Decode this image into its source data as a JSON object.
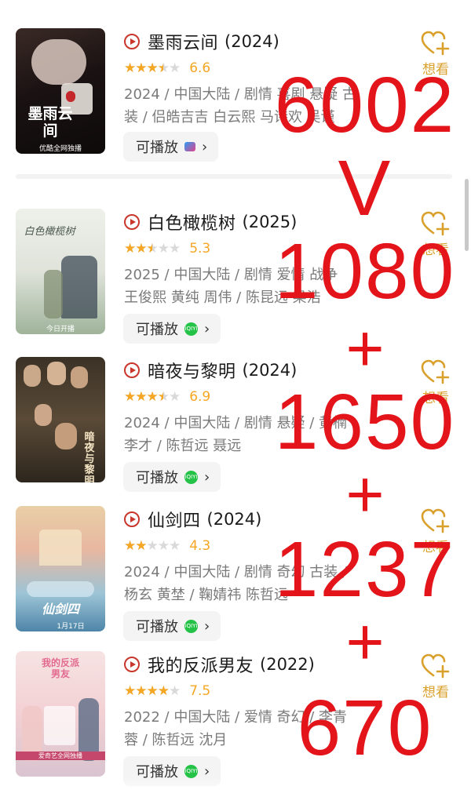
{
  "items": [
    {
      "title": "墨雨云间",
      "year": "(2024)",
      "stars": 3.5,
      "score": "6.6",
      "meta_line1": "2024 / 中国大陆 / 剧情 喜剧 悬疑 古",
      "meta_line2": "装 / 侣皓吉吉 白云熙 马诗欢 吴谨",
      "playable_label": "可播放",
      "platform": "youku",
      "want_label": "想看",
      "poster_text": "墨雨云间",
      "poster_caption": "优酷全网独播"
    },
    {
      "title": "白色橄榄树",
      "year": "(2025)",
      "stars": 2.5,
      "score": "5.3",
      "meta_line1": "2025 / 中国大陆 / 剧情 爱情 战争",
      "meta_line2": "王俊熙 黄纯 周伟 / 陈昆远 梁浩",
      "playable_label": "可播放",
      "platform": "iqiyi",
      "want_label": "想看",
      "poster_text": "白色橄榄树",
      "poster_caption": "今日开播"
    },
    {
      "title": "暗夜与黎明",
      "year": "(2024)",
      "stars": 3.5,
      "score": "6.9",
      "meta_line1": "2024 / 中国大陆 / 剧情 悬疑 / 黄楠",
      "meta_line2": "李才 / 陈哲远 聂远",
      "playable_label": "可播放",
      "platform": "iqiyi",
      "want_label": "想看",
      "poster_text": "暗夜与黎明",
      "poster_caption": ""
    },
    {
      "title": "仙剑四",
      "year": "(2024)",
      "stars": 2,
      "score": "4.3",
      "meta_line1": "2024 / 中国大陆 / 剧情 奇幻 古装 /",
      "meta_line2": "杨玄 黄埜 / 鞠婧祎 陈哲远",
      "playable_label": "可播放",
      "platform": "iqiyi",
      "want_label": "想看",
      "poster_text": "仙剑四",
      "poster_caption": "1月17日"
    },
    {
      "title": "我的反派男友",
      "year": "(2022)",
      "stars": 4,
      "score": "7.5",
      "meta_line1": "2022 / 中国大陆 / 爱情 奇幻 / 李青",
      "meta_line2": "蓉 / 陈哲远 沈月",
      "playable_label": "可播放",
      "platform": "iqiyi",
      "want_label": "想看",
      "poster_text": "我的反派男友",
      "poster_caption": "爱奇艺全网独播"
    }
  ],
  "overlay": {
    "n1": "6002",
    "v": "V",
    "n2": "1080",
    "plus1": "+",
    "n3": "1650",
    "plus2": "+",
    "n4": "1237",
    "plus3": "+",
    "n5": "670"
  },
  "colors": {
    "accent_red": "#c8362c",
    "overlay_red": "#e3141a",
    "star_gold": "#f5a623",
    "want_gold": "#d9a02b",
    "iqiyi_green": "#24c247"
  }
}
